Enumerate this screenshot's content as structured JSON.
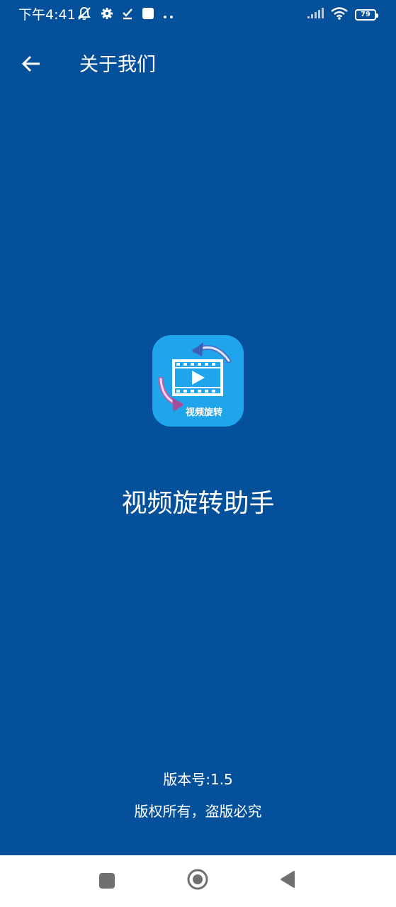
{
  "status_bar": {
    "time": "下午4:41",
    "battery_level": "79",
    "icons": [
      "notifications-muted-icon",
      "settings-gear-icon",
      "download-check-icon",
      "app-square-icon",
      "more-dots-icon",
      "signal-icon",
      "wifi-icon",
      "battery-icon"
    ]
  },
  "app_bar": {
    "title": "关于我们",
    "back_icon": "arrow-left-icon"
  },
  "app": {
    "icon_label": "视频旋转",
    "name": "视频旋转助手",
    "version": "版本号:1.5",
    "copyright": "版权所有，盗版必究"
  },
  "nav_bar": {
    "buttons": [
      "recent-apps-button",
      "home-button",
      "back-button"
    ]
  },
  "colors": {
    "background": "#05509b",
    "icon_background": "#1ea5ec",
    "nav_background": "#ffffff",
    "nav_icon": "#707070"
  }
}
